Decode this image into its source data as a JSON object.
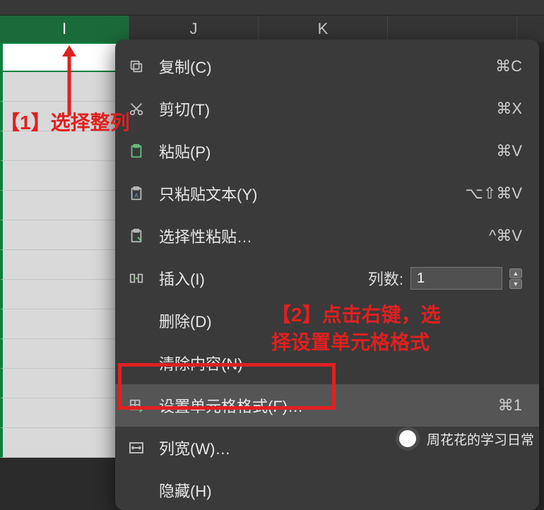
{
  "columns": {
    "I": "I",
    "J": "J",
    "K": "K"
  },
  "menu": {
    "copy": {
      "label": "复制(C)",
      "shortcut": "⌘C"
    },
    "cut": {
      "label": "剪切(T)",
      "shortcut": "⌘X"
    },
    "paste": {
      "label": "粘贴(P)",
      "shortcut": "⌘V"
    },
    "paste_text": {
      "label": "只粘贴文本(Y)",
      "shortcut": "⌥⇧⌘V"
    },
    "paste_sp": {
      "label": "选择性粘贴…",
      "shortcut": "^⌘V"
    },
    "insert": {
      "label": "插入(I)",
      "cols_label": "列数:",
      "cols_value": "1"
    },
    "delete": {
      "label": "删除(D)"
    },
    "clear": {
      "label": "清除内容(N)"
    },
    "format": {
      "label": "设置单元格格式(F)…",
      "shortcut": "⌘1"
    },
    "colwidth": {
      "label": "列宽(W)…"
    },
    "hide": {
      "label": "隐藏(H)"
    }
  },
  "annotations": {
    "step1": "【1】选择整列",
    "step2_line1": "【2】点击右键，选",
    "step2_line2": "择设置单元格格式"
  },
  "watermark": "周花花的学习日常"
}
